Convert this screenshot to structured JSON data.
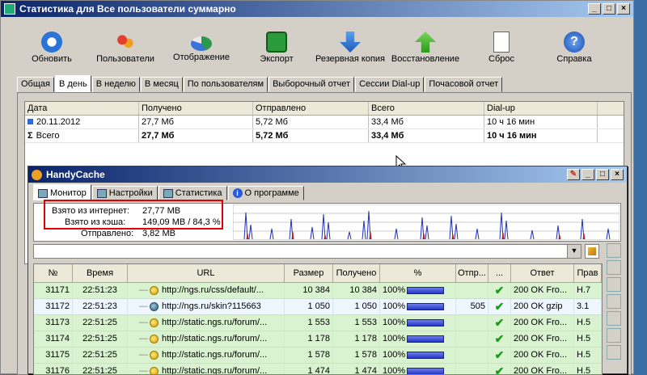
{
  "main_window": {
    "title": "Статистика для Все пользователи суммарно",
    "toolbar": [
      {
        "label": "Обновить",
        "icon": "refresh-icon"
      },
      {
        "label": "Пользователи",
        "icon": "users-icon"
      },
      {
        "label": "Отображение",
        "icon": "pie-chart-icon"
      },
      {
        "label": "Экспорт",
        "icon": "floppy-disk-icon"
      },
      {
        "label": "Резервная копия",
        "icon": "arrow-down-icon"
      },
      {
        "label": "Восстановление",
        "icon": "arrow-up-icon"
      },
      {
        "label": "Сброс",
        "icon": "document-icon"
      },
      {
        "label": "Справка",
        "icon": "help-icon"
      }
    ],
    "tabs": [
      "Общая",
      "В день",
      "В неделю",
      "В месяц",
      "По пользователям",
      "Выборочный отчет",
      "Сессии Dial-up",
      "Почасовой отчет"
    ],
    "active_tab": "В день",
    "table": {
      "headers": [
        "Дата",
        "Получено",
        "Отправлено",
        "Всего",
        "Dial-up"
      ],
      "rows": [
        {
          "date": "20.11.2012",
          "received": "27,7 Мб",
          "sent": "5,72 Мб",
          "total": "33,4 Мб",
          "dialup": "10 ч 16 мин"
        },
        {
          "date": "Всего",
          "received": "27,7 Мб",
          "sent": "5,72 Мб",
          "total": "33,4 Мб",
          "dialup": "10 ч 16 мин"
        }
      ]
    }
  },
  "handycache": {
    "title": "HandyCache",
    "tabs": [
      "Монитор",
      "Настройки",
      "Статистика",
      "О программе"
    ],
    "stats": {
      "internet_label": "Взято из интернет:",
      "internet_value": "27,77 MB",
      "cache_label": "Взято из кэша:",
      "cache_value": "149,09 MB / 84,3 %",
      "sent_label": "Отправлено:",
      "sent_value": "3,82 MB"
    },
    "columns": [
      "№",
      "Время",
      "URL",
      "Размер",
      "Получено",
      "%",
      "Отпр...",
      "...",
      "Ответ",
      "Прав"
    ],
    "rows": [
      {
        "n": "31171",
        "time": "22:51:23",
        "url": "http://ngs.ru/css/default/...",
        "size": "10 384",
        "received": "10 384",
        "pct": "100%",
        "sent": "",
        "answer": "200 OK Fro...",
        "right": "H.7"
      },
      {
        "n": "31172",
        "time": "22:51:23",
        "url": "http://ngs.ru/skin?115663",
        "size": "1 050",
        "received": "1 050",
        "pct": "100%",
        "sent": "505",
        "answer": "200 OK gzip",
        "right": "3.1"
      },
      {
        "n": "31173",
        "time": "22:51:25",
        "url": "http://static.ngs.ru/forum/...",
        "size": "1 553",
        "received": "1 553",
        "pct": "100%",
        "sent": "",
        "answer": "200 OK Fro...",
        "right": "H.5"
      },
      {
        "n": "31174",
        "time": "22:51:25",
        "url": "http://static.ngs.ru/forum/...",
        "size": "1 178",
        "received": "1 178",
        "pct": "100%",
        "sent": "",
        "answer": "200 OK Fro...",
        "right": "H.5"
      },
      {
        "n": "31175",
        "time": "22:51:25",
        "url": "http://static.ngs.ru/forum/...",
        "size": "1 578",
        "received": "1 578",
        "pct": "100%",
        "sent": "",
        "answer": "200 OK Fro...",
        "right": "H.5"
      },
      {
        "n": "31176",
        "time": "22:51:25",
        "url": "http://static.ngs.ru/forum/...",
        "size": "1 474",
        "received": "1 474",
        "pct": "100%",
        "sent": "",
        "answer": "200 OK Fro...",
        "right": "H.5"
      }
    ]
  }
}
